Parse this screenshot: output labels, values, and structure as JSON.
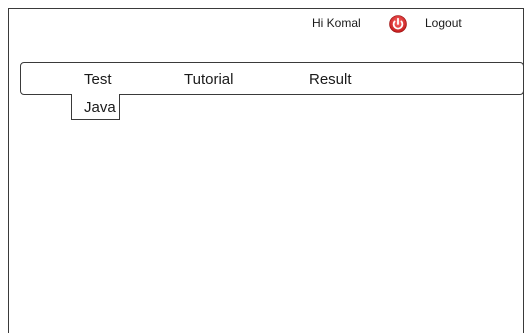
{
  "header": {
    "greeting": "Hi Komal",
    "logout_label": "Logout",
    "power_icon": "power-icon",
    "power_color": "#d62828"
  },
  "nav": {
    "items": [
      {
        "label": "Test"
      },
      {
        "label": "Tutorial"
      },
      {
        "label": "Result"
      }
    ]
  },
  "dropdown": {
    "items": [
      {
        "label": "Java"
      }
    ]
  }
}
